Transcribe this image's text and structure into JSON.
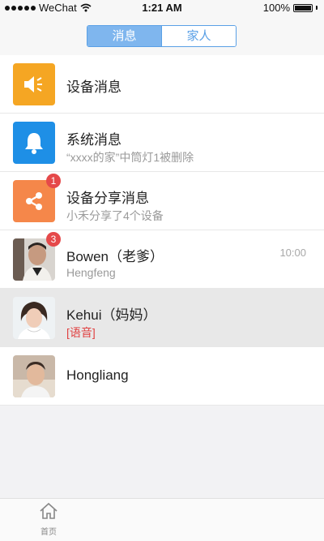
{
  "status_bar": {
    "carrier": "WeChat",
    "time": "1:21 AM",
    "battery": "100%",
    "battery_level": 1.0
  },
  "segmented": {
    "tabs": [
      "消息",
      "家人"
    ],
    "active_index": 0
  },
  "messages": [
    {
      "title": "设备消息",
      "subtitle": "",
      "icon": "speaker-icon",
      "icon_color": "#f5a623"
    },
    {
      "title": "系统消息",
      "subtitle": "“xxxx的家”中筒灯1被删除",
      "icon": "bell-icon",
      "icon_color": "#1e8fe6"
    },
    {
      "title": "设备分享消息",
      "subtitle": "小禾分享了4个设备",
      "icon": "share-icon",
      "icon_color": "#f5874a",
      "badge": "1"
    },
    {
      "title": "Bowen（老爹）",
      "subtitle": "Hengfeng",
      "time": "10:00",
      "badge": "3",
      "avatar": "avatar-bowen"
    },
    {
      "title": "Kehui（妈妈）",
      "subtitle": "[语音]",
      "avatar": "avatar-kehui"
    },
    {
      "title": "Hongliang",
      "subtitle": "",
      "avatar": "avatar-hongliang"
    }
  ],
  "tabbar": {
    "home_label": "首页",
    "home_icon": "home-icon"
  }
}
